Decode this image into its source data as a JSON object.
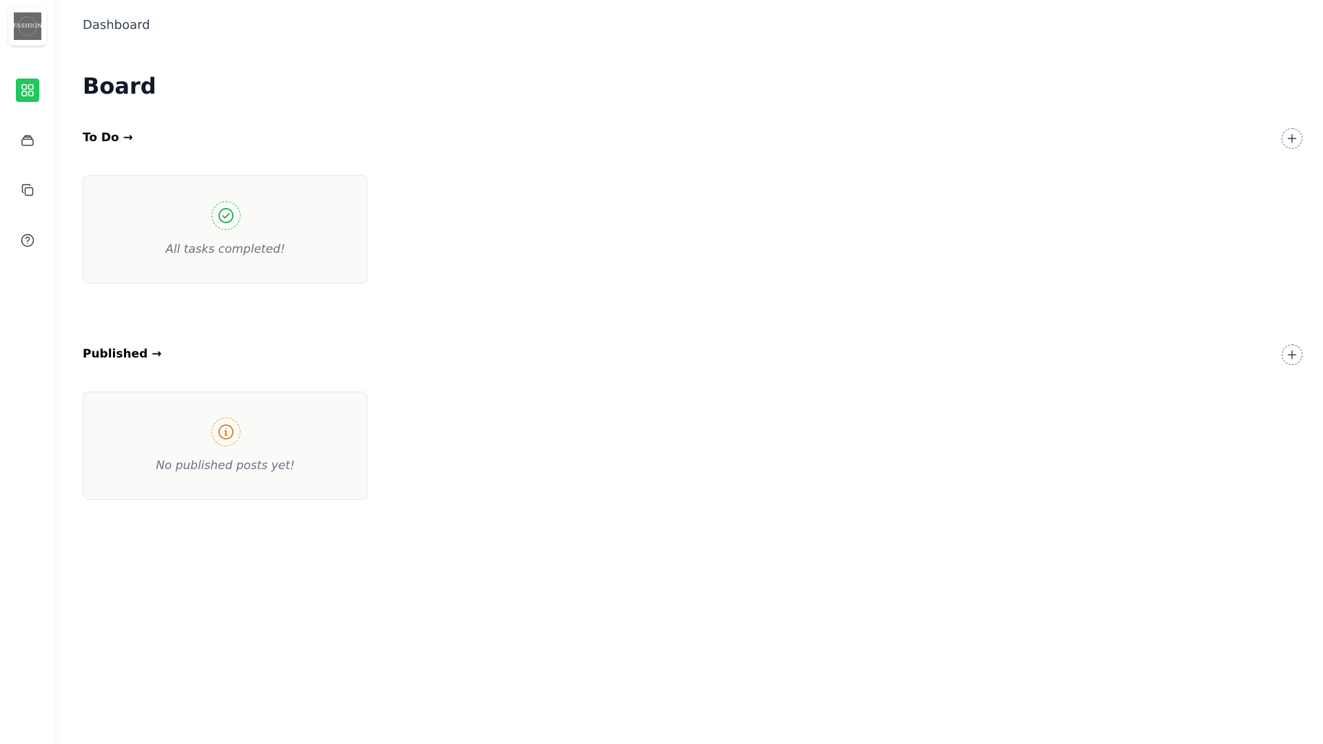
{
  "brand": {
    "logo_text": "FASHION"
  },
  "sidebar": {
    "items": [
      {
        "name": "dashboard",
        "icon": "grid-icon",
        "active": true
      },
      {
        "name": "inbox",
        "icon": "stack-icon",
        "active": false
      },
      {
        "name": "copy",
        "icon": "copy-icon",
        "active": false
      },
      {
        "name": "help",
        "icon": "help-circle-icon",
        "active": false
      }
    ],
    "accent_color": "#22c55e"
  },
  "header": {
    "breadcrumb": "Dashboard"
  },
  "page": {
    "title": "Board"
  },
  "sections": [
    {
      "title": "To Do →",
      "add_icon": "plus-icon",
      "empty_state": {
        "icon": "check-circle-icon",
        "text": "All tasks completed!",
        "color": "#22c55e"
      }
    },
    {
      "title": "Published →",
      "add_icon": "plus-icon",
      "empty_state": {
        "icon": "info-circle-icon",
        "text": "No published posts yet!",
        "color": "#f59e0b"
      }
    }
  ]
}
